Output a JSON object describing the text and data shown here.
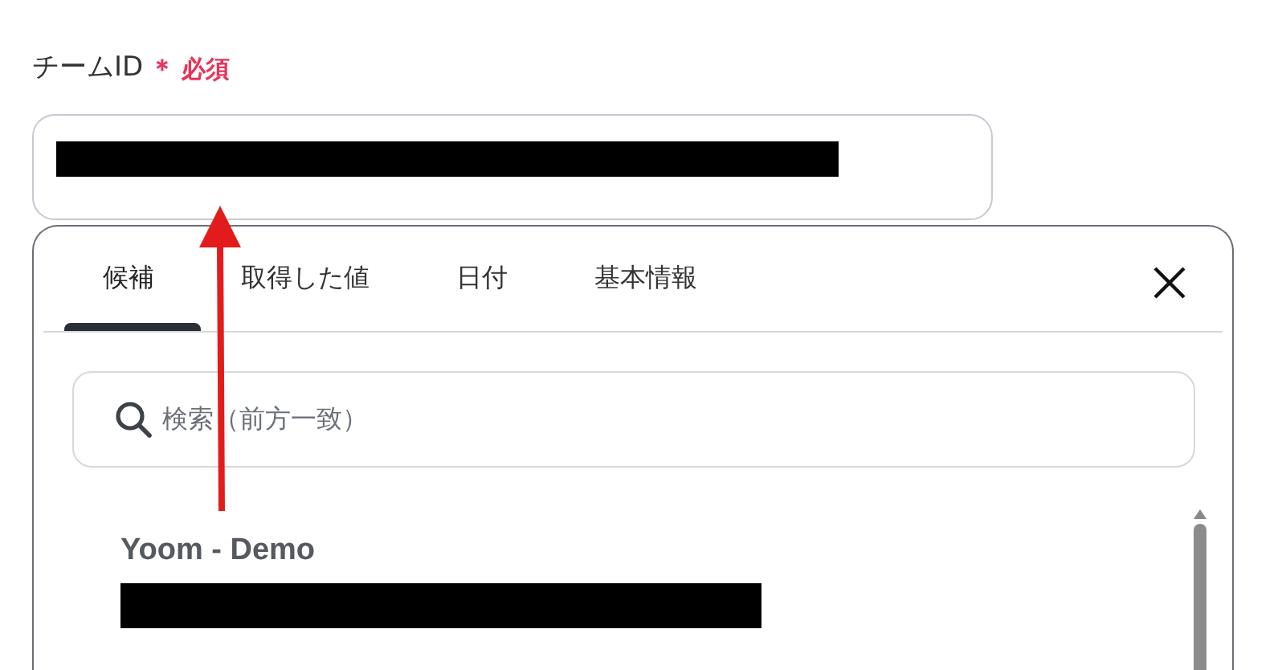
{
  "field": {
    "label": "チームID",
    "required_mark": "＊",
    "required_text": "必須"
  },
  "tabs": [
    {
      "label": "候補",
      "selected": true
    },
    {
      "label": "取得した値",
      "selected": false
    },
    {
      "label": "日付",
      "selected": false
    },
    {
      "label": "基本情報",
      "selected": false
    }
  ],
  "search": {
    "placeholder": "検索（前方一致）"
  },
  "options": [
    {
      "name": "Yoom - Demo"
    }
  ]
}
